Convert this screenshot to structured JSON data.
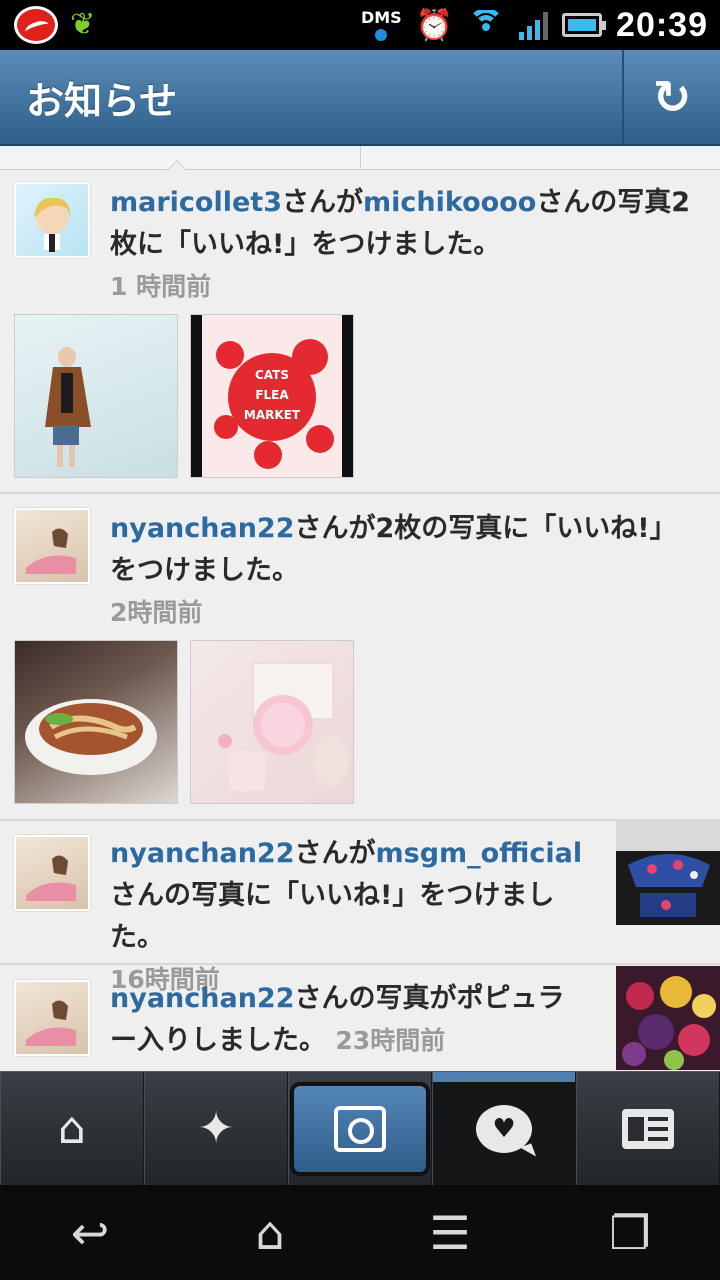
{
  "status_bar": {
    "dms_label": "DMS",
    "time": "20:39"
  },
  "header": {
    "title": "お知らせ"
  },
  "notifications": [
    {
      "user": "maricollet3",
      "text_1": "さんが",
      "target": "michikoooo",
      "text_2": "さんの写真2枚に「いいね!」をつけました。",
      "time": "1 時間前"
    },
    {
      "user": "nyanchan22",
      "text_1": "さんが2枚の写真に「いいね!」をつけました。",
      "time": "2時間前"
    },
    {
      "user": "nyanchan22",
      "text_1": "さんが",
      "target": "msgm_official",
      "text_2": "さんの写真に「いいね!」をつけました。",
      "time": "16時間前"
    },
    {
      "user": "nyanchan22",
      "text_1": "さんの写真がポピュラー入りしました。",
      "time": "23時間前"
    }
  ],
  "photo_texts": {
    "cats_flea_market": "CATS FLEA MARKET"
  },
  "tabbar": {
    "items": [
      "home-icon",
      "explore-icon",
      "camera-icon",
      "activity-icon",
      "profile-icon"
    ],
    "active": "activity-icon"
  },
  "colors": {
    "header": "#3f729b",
    "username": "#2d6aa0",
    "time": "#9a9a9a"
  }
}
